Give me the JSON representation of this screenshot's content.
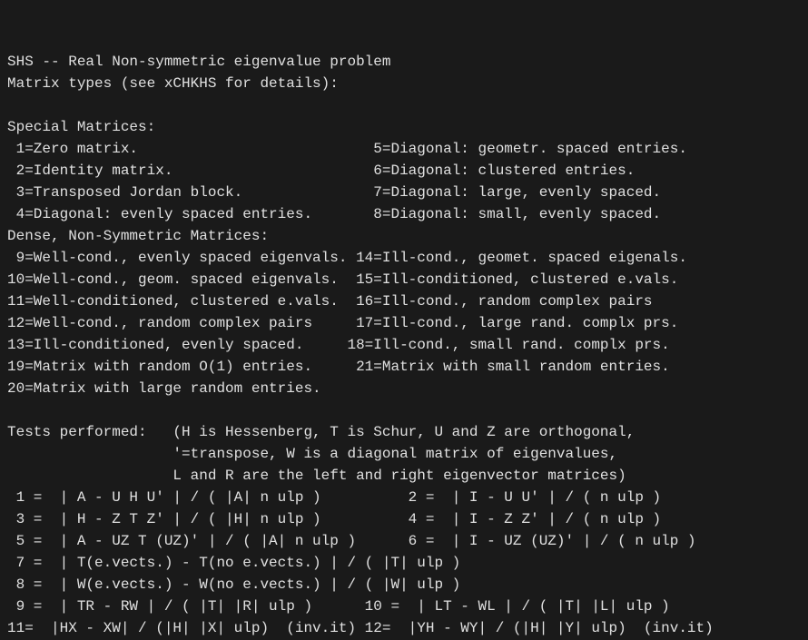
{
  "header": {
    "title": "SHS -- Real Non-symmetric eigenvalue problem",
    "subtitle": "Matrix types (see xCHKHS for details):"
  },
  "special_header": "Special Matrices:",
  "special_left": [
    " 1=Zero matrix.",
    " 2=Identity matrix.",
    " 3=Transposed Jordan block.",
    " 4=Diagonal: evenly spaced entries."
  ],
  "special_right": [
    " 5=Diagonal: geometr. spaced entries.",
    " 6=Diagonal: clustered entries.",
    " 7=Diagonal: large, evenly spaced.",
    " 8=Diagonal: small, evenly spaced."
  ],
  "dense_header": "Dense, Non-Symmetric Matrices:",
  "dense_left": [
    " 9=Well-cond., evenly spaced eigenvals.",
    "10=Well-cond., geom. spaced eigenvals.",
    "11=Well-conditioned, clustered e.vals.",
    "12=Well-cond., random complex pairs",
    "13=Ill-conditioned, evenly spaced."
  ],
  "dense_right": [
    "14=Ill-cond., geomet. spaced eigenals.",
    "15=Ill-conditioned, clustered e.vals.",
    "16=Ill-cond., random complex pairs",
    "17=Ill-cond., large rand. complx prs.",
    "18=Ill-cond., small rand. complx prs."
  ],
  "rand_left": [
    "19=Matrix with random O(1) entries.",
    "20=Matrix with large random entries."
  ],
  "rand_right": [
    "21=Matrix with small random entries."
  ],
  "tests_header": "Tests performed:   (H is Hessenberg, T is Schur, U and Z are orthogonal,",
  "tests_line2": "                   '=transpose, W is a diagonal matrix of eigenvalues,",
  "tests_line3": "                   L and R are the left and right eigenvector matrices)",
  "test_rows": [
    {
      "l": " 1 =  | A - U H U' | / ( |A| n ulp )         ",
      "r": " 2 =  | I - U U' | / ( n ulp )"
    },
    {
      "l": " 3 =  | H - Z T Z' | / ( |H| n ulp )         ",
      "r": " 4 =  | I - Z Z' | / ( n ulp )"
    },
    {
      "l": " 5 =  | A - UZ T (UZ)' | / ( |A| n ulp )     ",
      "r": " 6 =  | I - UZ (UZ)' | / ( n ulp )"
    },
    {
      "l": " 7 =  | T(e.vects.) - T(no e.vects.) | / ( |T| ulp )",
      "r": ""
    },
    {
      "l": " 8 =  | W(e.vects.) - W(no e.vects.) | / ( |W| ulp )",
      "r": ""
    },
    {
      "l": " 9 =  | TR - RW | / ( |T| |R| ulp )     ",
      "r": "10 =  | LT - WL | / ( |T| |L| ulp )"
    },
    {
      "l": "11=  |HX - XW| / (|H| |X| ulp)  (inv.it)",
      "r": "12=  |YH - WY| / (|H| |Y| ulp)  (inv.it)"
    }
  ]
}
